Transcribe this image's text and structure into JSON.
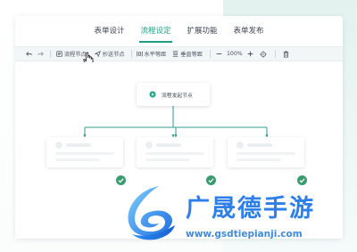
{
  "tabs": [
    {
      "label": "表单设计",
      "active": false
    },
    {
      "label": "流程设定",
      "active": true
    },
    {
      "label": "扩展功能",
      "active": false
    },
    {
      "label": "表单发布",
      "active": false
    }
  ],
  "toolbar": {
    "undo_icon": "undo-icon",
    "redo_icon": "redo-icon",
    "approval_node": "流程节点",
    "cc_node": "抄送节点",
    "horizontal_equal": "水平等距",
    "vertical_equal": "垂直等距",
    "zoom": "100%",
    "zoom_out_icon": "minus-icon",
    "zoom_in_icon": "plus-icon",
    "locate_icon": "target-icon",
    "delete_icon": "trash-icon"
  },
  "canvas": {
    "root_node": "流程发起节点",
    "child_nodes": [
      {
        "status": "complete"
      },
      {
        "status": "complete"
      },
      {
        "status": "complete"
      }
    ]
  },
  "watermark": {
    "brand": "广晟德手游",
    "url": "www.gsdtiepianji.com"
  },
  "colors": {
    "accent": "#1f9e82",
    "connector": "#2a9d8f",
    "check": "#3a9c6e",
    "watermark_blue": "#2f7fe8"
  }
}
